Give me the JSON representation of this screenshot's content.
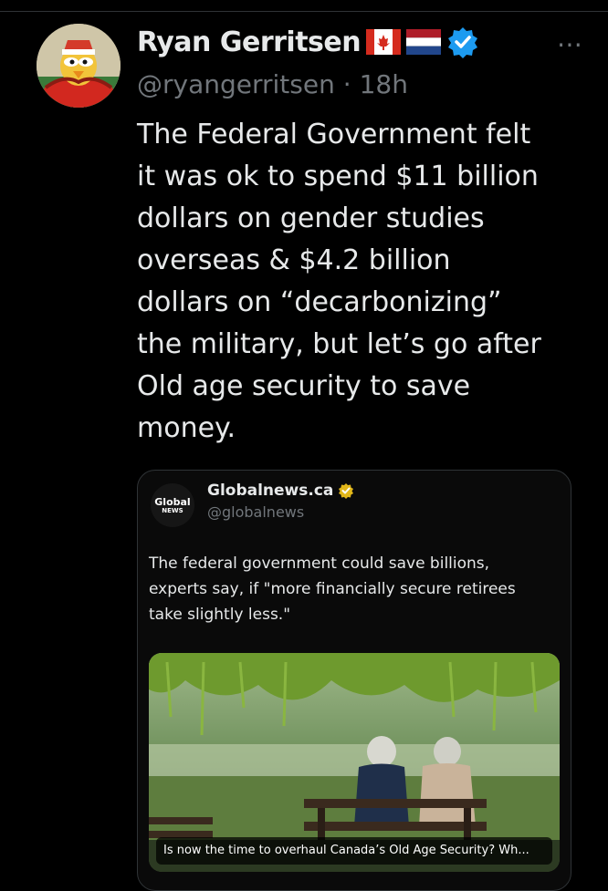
{
  "author": {
    "name": "Ryan Gerritsen",
    "handle": "@ryangerritsen",
    "separator": "·",
    "time": "18h",
    "flags": [
      "canada-flag",
      "netherlands-flag"
    ],
    "verified": true,
    "more_icon": "⋯"
  },
  "tweet": {
    "text": "The Federal Government felt\nit was ok to spend $11 billion\ndollars on gender studies\noverseas & $4.2 billion\ndollars on “decarbonizing”\nthe military, but let’s go after\nOld age security to save\nmoney."
  },
  "quote": {
    "logo_line1": "Global",
    "logo_line2": "NEWS",
    "name": "Globalnews.ca",
    "handle": "@globalnews",
    "verified_color": "#e2b719",
    "text": "The federal government could save billions,\nexperts say, if \"more financially secure retirees\ntake slightly less.\"",
    "media_caption": "Is now the time to overhaul Canada’s Old Age Security? Wh..."
  },
  "colors": {
    "background": "#000000",
    "text": "#e7e9ea",
    "muted": "#71767b",
    "verified": "#1d9bf0",
    "border": "#2f3336"
  }
}
